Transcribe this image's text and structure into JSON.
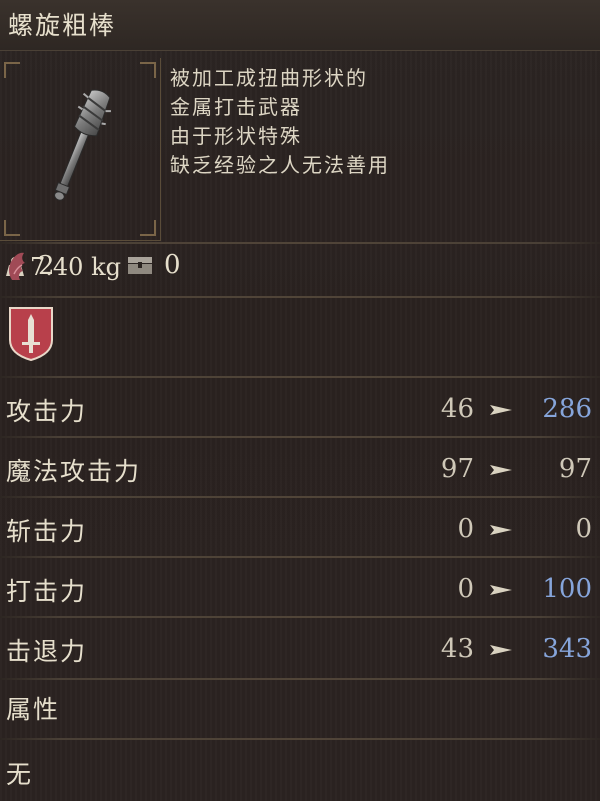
{
  "item": {
    "name": "螺旋粗棒",
    "weight": "7.40 kg",
    "description": [
      "被加工成扭曲形状的",
      "金属打击武器",
      "由于形状特殊",
      "缺乏经验之人无法善用"
    ]
  },
  "counts": {
    "owned": "2",
    "stored": "0"
  },
  "icons": {
    "weapon": "spiral-club-icon",
    "weight": "weight-icon",
    "owned": "hand-icon",
    "storage": "chest-icon",
    "class_badge": "sword-shield-icon",
    "arrow": "arrow-right-icon"
  },
  "stats": [
    {
      "label": "攻击力",
      "old": "46",
      "new": "286",
      "change": "up"
    },
    {
      "label": "魔法攻击力",
      "old": "97",
      "new": "97",
      "change": "same"
    },
    {
      "label": "斩击力",
      "old": "0",
      "new": "0",
      "change": "same"
    },
    {
      "label": "打击力",
      "old": "0",
      "new": "100",
      "change": "up"
    },
    {
      "label": "击退力",
      "old": "43",
      "new": "343",
      "change": "up"
    }
  ],
  "attribute": {
    "label": "属性",
    "value": "无"
  },
  "colors": {
    "increase": "#86a5db",
    "unchanged": "#cfc8b8",
    "badge": "#b8404b"
  }
}
